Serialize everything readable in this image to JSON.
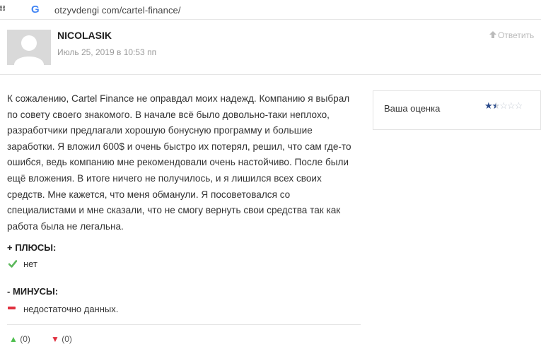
{
  "browser": {
    "url": "otzyvdengi com/cartel-finance/",
    "icons": {
      "apps": "apps-grid-icon",
      "site": "google-icon"
    }
  },
  "comment": {
    "author": "NICOLASIK",
    "date": "Июль 25, 2019 в 10:53 пп",
    "reply_label": "Ответить",
    "text": "К сожалению, Cartel Finance не оправдал моих надежд. Компанию я выбрал по совету своего знакомого. В начале всё было довольно-таки неплохо, разработчики предлагали хорошую бонусную программу и большие заработки. Я вложил 600$ и очень быстро их потерял, решил, что сам где-то ошибся, ведь компанию мне рекомендовали очень настойчиво. После были ещё вложения. В итоге ничего не получилось, и я лишился всех своих средств. Мне кажется, что меня обманули. Я посоветовался со специалистами и мне сказали, что не смогу вернуть свои средства так как работа была не легальна.",
    "rating": {
      "label": "Ваша оценка",
      "value": 1.5,
      "max": 5,
      "color_on": "#2a4a8b",
      "color_off": "#c7cdd6"
    },
    "pros": {
      "title": "+ ПЛЮСЫ:",
      "item": "нет"
    },
    "cons": {
      "title": "- МИНУСЫ:",
      "item": "недостаточно данных."
    },
    "votes": {
      "up": "(0)",
      "down": "(0)"
    }
  },
  "colors": {
    "check": "#5cb85c",
    "minus": "#e0303f",
    "muted": "#9a9a9a"
  }
}
